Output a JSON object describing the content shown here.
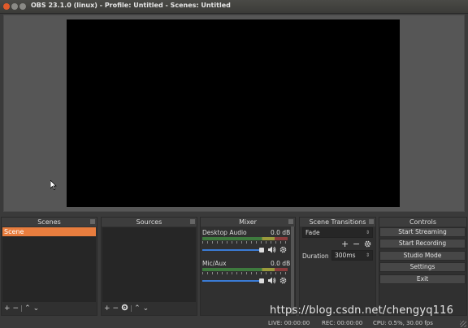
{
  "window": {
    "title": "OBS 23.1.0 (linux) - Profile: Untitled - Scenes: Untitled"
  },
  "scenes": {
    "header": "Scenes",
    "items": [
      "Scene"
    ]
  },
  "sources": {
    "header": "Sources"
  },
  "mixer": {
    "header": "Mixer",
    "channels": [
      {
        "name": "Desktop Audio",
        "db": "0.0 dB"
      },
      {
        "name": "Mic/Aux",
        "db": "0.0 dB"
      }
    ]
  },
  "transitions": {
    "header": "Scene Transitions",
    "selected": "Fade",
    "duration_label": "Duration",
    "duration_value": "300ms"
  },
  "controls": {
    "header": "Controls",
    "start_streaming": "Start Streaming",
    "start_recording": "Start Recording",
    "studio_mode": "Studio Mode",
    "settings": "Settings",
    "exit": "Exit"
  },
  "toolbar": {
    "add": "+",
    "remove": "−",
    "up": "⌃",
    "down": "⌄"
  },
  "status": {
    "live": "LIVE: 00:00:00",
    "rec": "REC: 00:00:00",
    "cpu": "CPU: 0.5%, 30.00 fps"
  },
  "watermark": "https://blog.csdn.net/chengyq116",
  "colors": {
    "selected_scene": "#e87d3e",
    "volume_slider": "#3a7bd5"
  }
}
